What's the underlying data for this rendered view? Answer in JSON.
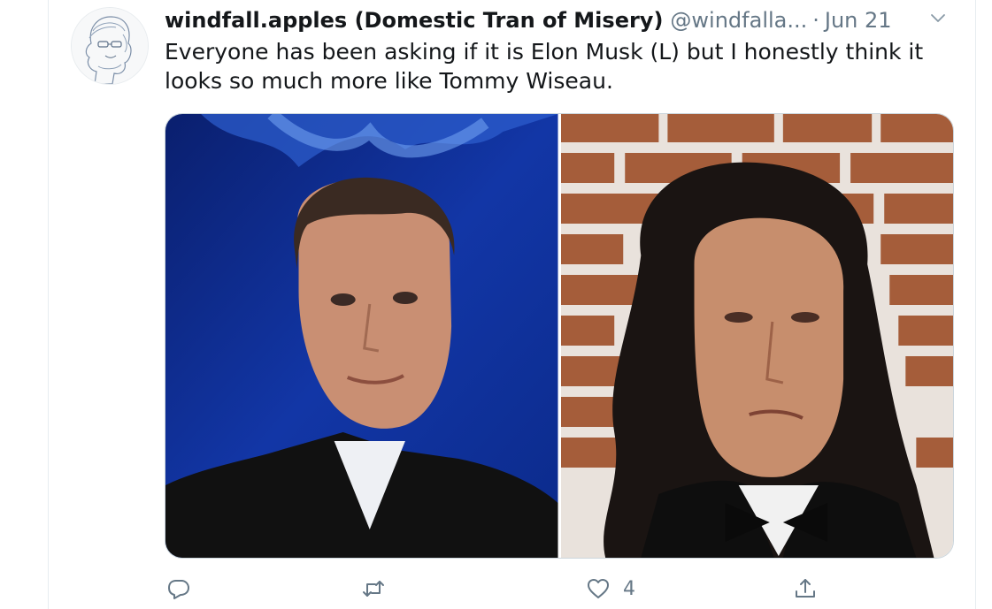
{
  "tweet": {
    "display_name": "windfall.apples (Domestic Tran of Misery)",
    "handle": "@windfalla...",
    "separator": "·",
    "date": "Jun 21",
    "text": "Everyone has been asking if it is Elon Musk (L) but I honestly think it looks so much more like Tommy Wiseau.",
    "media": [
      {
        "description_icon": "photo-left"
      },
      {
        "description_icon": "photo-right"
      }
    ]
  },
  "actions": {
    "reply_icon": "reply-icon",
    "retweet_icon": "retweet-icon",
    "like_icon": "heart-icon",
    "like_count": "4",
    "share_icon": "share-icon"
  },
  "colors": {
    "text_primary": "#14171a",
    "text_secondary": "#657786",
    "border": "#ccd6dd"
  }
}
